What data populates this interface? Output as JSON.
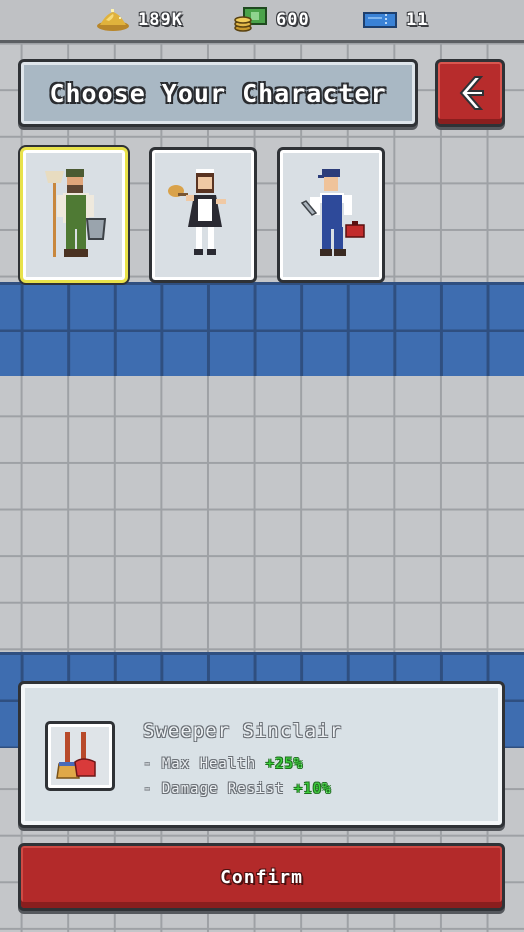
{
  "resources": {
    "gold": {
      "value": "189K",
      "icon": "gold-pile-icon"
    },
    "cash": {
      "value": "600",
      "icon": "cash-stack-icon"
    },
    "tickets": {
      "value": "11",
      "icon": "ticket-icon"
    }
  },
  "header": {
    "title": "Choose Your Character",
    "back_icon": "back-arrow-icon"
  },
  "characters": [
    {
      "id": "sweeper",
      "icon": "janitor-character-icon",
      "selected": true
    },
    {
      "id": "maid",
      "icon": "maid-character-icon",
      "selected": false
    },
    {
      "id": "mechanic",
      "icon": "mechanic-character-icon",
      "selected": false
    }
  ],
  "selected_character": {
    "name": "Sweeper Sinclair",
    "icon": "broom-plunger-icon",
    "stats": [
      {
        "label": "- Max Health",
        "value": "+25%"
      },
      {
        "label": "- Damage Resist",
        "value": "+10%"
      }
    ]
  },
  "actions": {
    "confirm_label": "Confirm"
  },
  "colors": {
    "accent_red": "#b32a2a",
    "selected_outline": "#e8e24a",
    "bonus_green": "#3cd23c",
    "floor_blue": "#3e6db0"
  }
}
